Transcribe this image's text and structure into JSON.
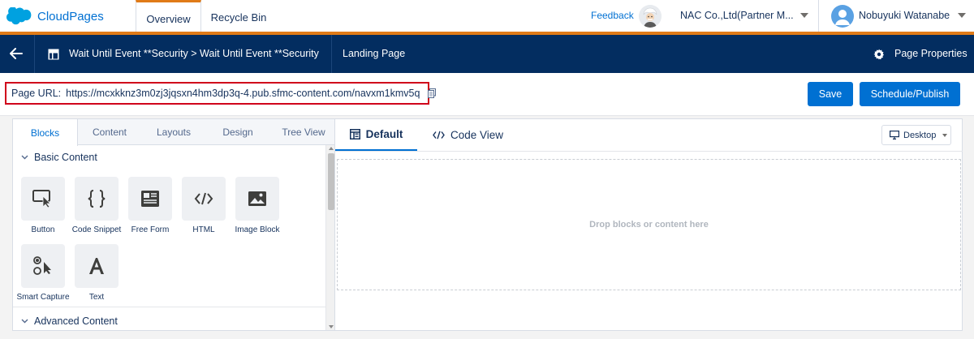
{
  "app": {
    "name": "CloudPages",
    "tabs": [
      {
        "label": "Overview",
        "active": true
      },
      {
        "label": "Recycle Bin",
        "active": false
      }
    ],
    "feedback_label": "Feedback",
    "org_name": "NAC Co.,Ltd(Partner M...",
    "user_name": "Nobuyuki Watanabe",
    "colors": {
      "brand": "#0070d2",
      "accent": "#e07b18",
      "nav": "#032d60"
    }
  },
  "header": {
    "breadcrumb": "Wait Until Event **Security > Wait Until Event **Security",
    "page_type": "Landing Page",
    "properties_label": "Page Properties"
  },
  "url_bar": {
    "label": "Page URL:",
    "url": "https://mcxkknz3m0zj3jqsxn4hm3dp3q-4.pub.sfmc-content.com/navxm1kmv5q"
  },
  "actions": {
    "save": "Save",
    "publish": "Schedule/Publish"
  },
  "left_panel": {
    "tabs": [
      {
        "label": "Blocks",
        "active": true
      },
      {
        "label": "Content"
      },
      {
        "label": "Layouts"
      },
      {
        "label": "Design"
      },
      {
        "label": "Tree View"
      }
    ],
    "sections": [
      {
        "title": "Basic Content",
        "blocks": [
          {
            "label": "Button",
            "icon": "button-click-icon"
          },
          {
            "label": "Code Snippet",
            "icon": "braces-icon"
          },
          {
            "label": "Free Form",
            "icon": "free-form-icon"
          },
          {
            "label": "HTML",
            "icon": "html-code-icon"
          },
          {
            "label": "Image Block",
            "icon": "image-icon"
          },
          {
            "label": "Smart Capture",
            "icon": "smart-capture-icon"
          },
          {
            "label": "Text",
            "icon": "text-a-icon"
          }
        ]
      },
      {
        "title": "Advanced Content"
      }
    ]
  },
  "canvas": {
    "tabs": [
      {
        "label": "Default",
        "active": true
      },
      {
        "label": "Code View"
      }
    ],
    "device": "Desktop",
    "placeholder": "Drop blocks or content here"
  }
}
